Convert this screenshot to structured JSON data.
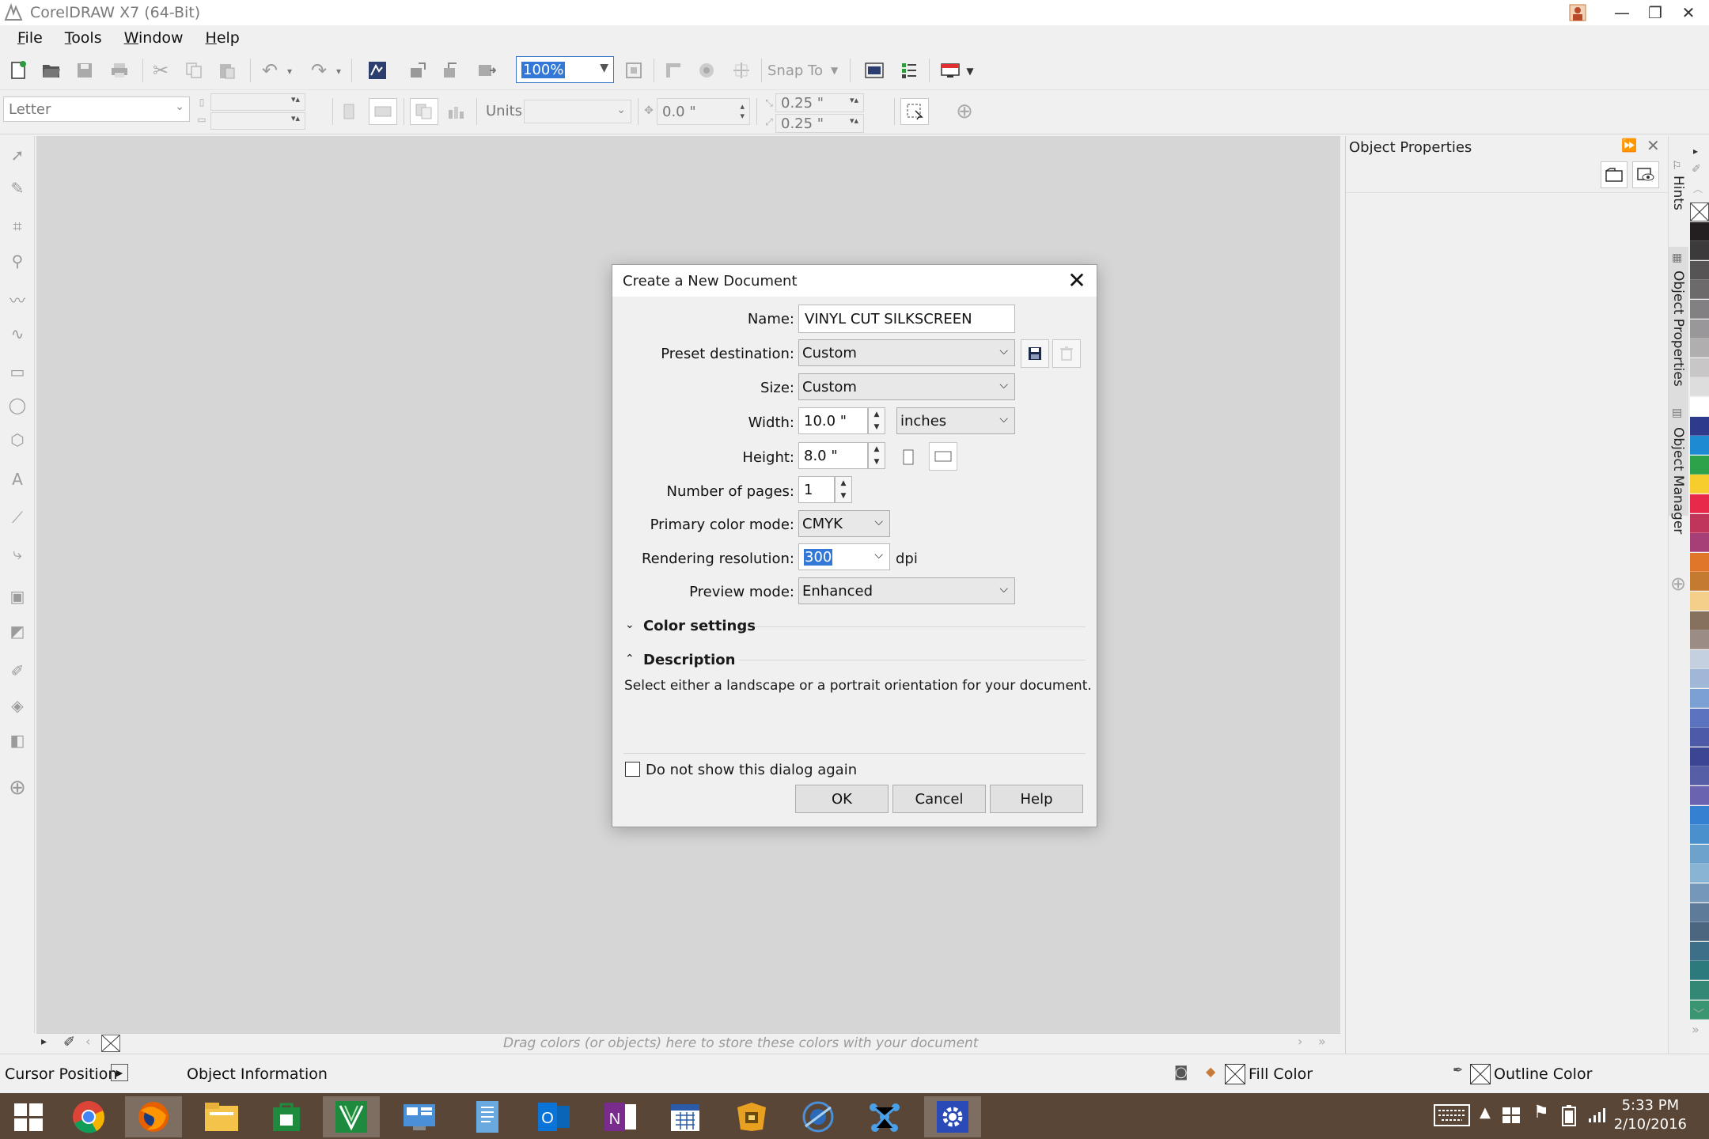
{
  "window": {
    "title": "CorelDRAW X7 (64-Bit)"
  },
  "menu": [
    {
      "label": "File"
    },
    {
      "label": "Tools"
    },
    {
      "label": "Window"
    },
    {
      "label": "Help"
    }
  ],
  "toolbar": {
    "zoom": "100%",
    "snap_to": "Snap To"
  },
  "property_bar": {
    "page_size": "Letter",
    "units_label": "Units:",
    "nudge": "0.0 \"",
    "dup_x": "0.25 \"",
    "dup_y": "0.25 \""
  },
  "docker": {
    "title": "Object Properties",
    "tabs": [
      "Hints",
      "Object Properties",
      "Object Manager"
    ]
  },
  "palette_colors": [
    "#ffffff",
    "#231f20",
    "#3d3a3b",
    "#575456",
    "#6d6a6c",
    "#838083",
    "#9a979a",
    "#b1aeb0",
    "#c8c6c7",
    "#dedddd",
    "#ffffff",
    "#2e3a8c",
    "#1e8ad2",
    "#2ea24a",
    "#f6cd2d",
    "#e8294a",
    "#c0365a",
    "#a63f78",
    "#e0762a",
    "#c47a2f",
    "#f3cf8a",
    "#86715e",
    "#9b8c85",
    "#c4cfe0",
    "#a0b7d8",
    "#7aa0d4",
    "#5c74c0",
    "#4c5aa8",
    "#3b4592",
    "#565ea6",
    "#6a64b0",
    "#3580d0",
    "#4a90cc",
    "#6ca2cc",
    "#89b4d4",
    "#7597b8",
    "#5e7b9a",
    "#4d6680",
    "#3d7088",
    "#2d7a7c",
    "#338875",
    "#3a9670"
  ],
  "doc_palette": {
    "hint": "Drag colors (or objects) here to store these colors with your document"
  },
  "status": {
    "cursor_position": "Cursor Position",
    "object_information": "Object Information",
    "fill_color": "Fill Color",
    "outline_color": "Outline Color"
  },
  "dialog": {
    "title": "Create a New Document",
    "name_label": "Name:",
    "name_value": "VINYL CUT SILKSCREEN",
    "preset_label": "Preset destination:",
    "preset_value": "Custom",
    "size_label": "Size:",
    "size_value": "Custom",
    "width_label": "Width:",
    "width_value": "10.0 \"",
    "units_value": "inches",
    "height_label": "Height:",
    "height_value": "8.0 \"",
    "pages_label": "Number of pages:",
    "pages_value": "1",
    "color_mode_label": "Primary color mode:",
    "color_mode_value": "CMYK",
    "resolution_label": "Rendering resolution:",
    "resolution_value": "300",
    "resolution_unit": "dpi",
    "preview_label": "Preview mode:",
    "preview_value": "Enhanced",
    "color_settings": "Color settings",
    "description_header": "Description",
    "description_text": "Select either a landscape or a portrait orientation for your document.",
    "dont_show": "Do not show this dialog again",
    "ok": "OK",
    "cancel": "Cancel",
    "help": "Help"
  },
  "taskbar": {
    "time": "5:33 PM",
    "date": "2/10/2016"
  }
}
